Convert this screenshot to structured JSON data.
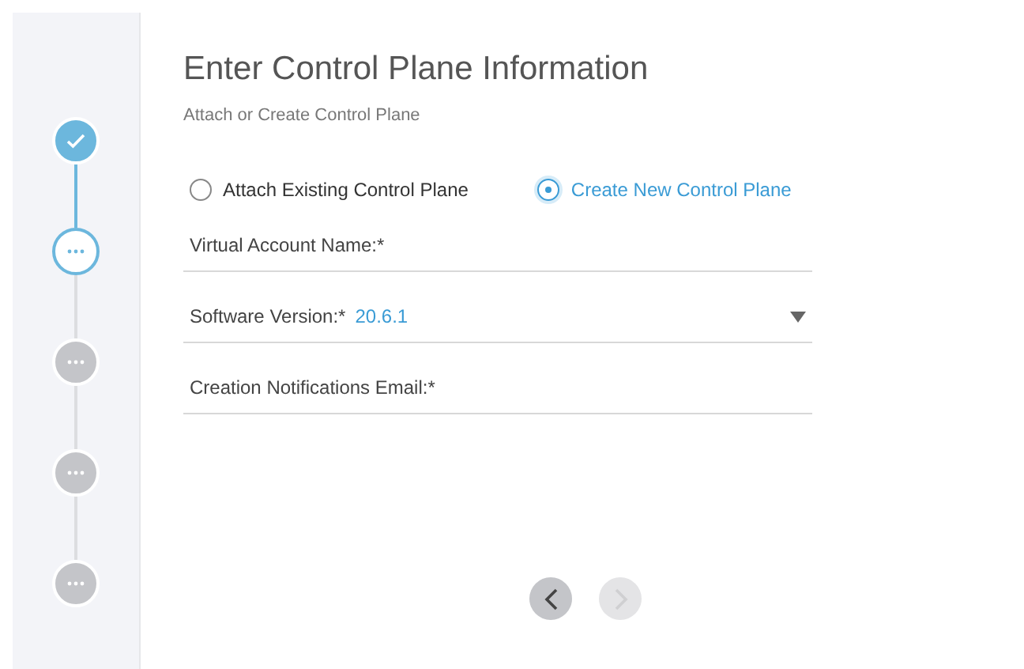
{
  "steps": [
    {
      "kind": "done"
    },
    {
      "kind": "current"
    },
    {
      "kind": "pending"
    },
    {
      "kind": "pending"
    },
    {
      "kind": "pending"
    }
  ],
  "title": "Enter Control Plane Information",
  "subtitle": "Attach or Create Control Plane",
  "options": [
    {
      "label": "Attach Existing Control Plane",
      "selected": false
    },
    {
      "label": "Create New Control Plane",
      "selected": true
    }
  ],
  "fields": [
    {
      "label": "Virtual Account Name:*",
      "kind": "text"
    },
    {
      "label": "Software Version:*",
      "value": "20.6.1",
      "kind": "dropdown"
    },
    {
      "label": "Creation Notifications Email:*",
      "kind": "text"
    }
  ],
  "nav": {
    "back_disabled": false,
    "next_disabled": true
  }
}
